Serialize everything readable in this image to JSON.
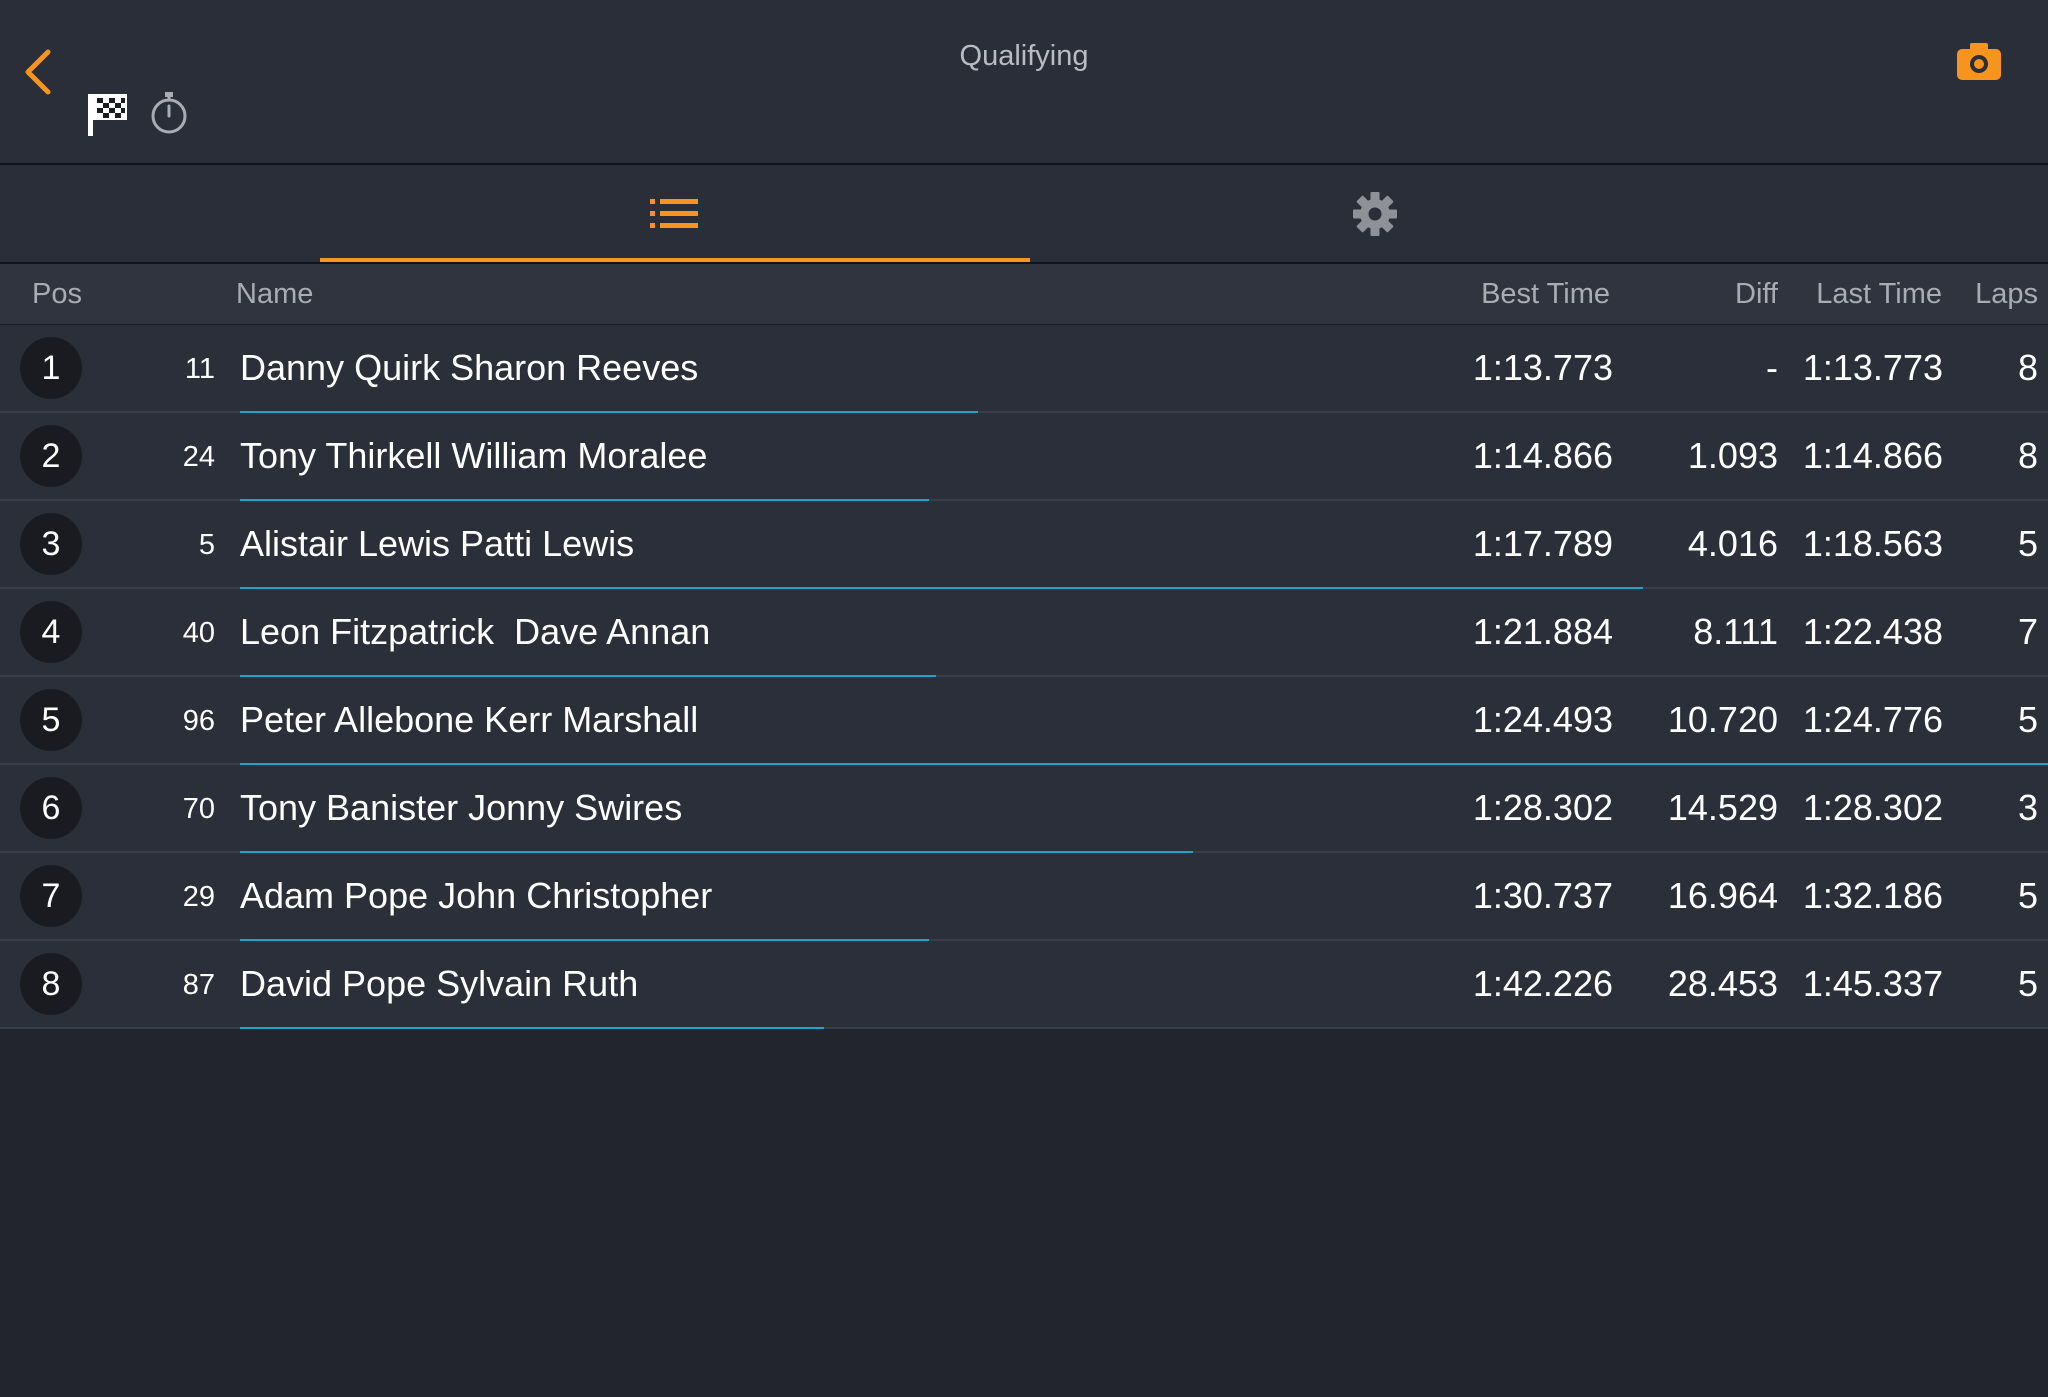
{
  "header": {
    "title": "Qualifying"
  },
  "columns": {
    "pos": "Pos",
    "name": "Name",
    "best_time": "Best Time",
    "diff": "Diff",
    "last_time": "Last Time",
    "laps": "Laps"
  },
  "colors": {
    "accent": "#f7941d",
    "progress": "#1aa6c8",
    "background": "#22252d"
  },
  "rows": [
    {
      "pos": "1",
      "car": "11",
      "name": "Danny Quirk Sharon Reeves",
      "best": "1:13.773",
      "diff": "-",
      "last": "1:13.773",
      "laps": "8",
      "progress": 0.408
    },
    {
      "pos": "2",
      "car": "24",
      "name": "Tony Thirkell William Moralee",
      "best": "1:14.866",
      "diff": "1.093",
      "last": "1:14.866",
      "laps": "8",
      "progress": 0.381
    },
    {
      "pos": "3",
      "car": "5",
      "name": "Alistair Lewis Patti Lewis",
      "best": "1:17.789",
      "diff": "4.016",
      "last": "1:18.563",
      "laps": "5",
      "progress": 0.776
    },
    {
      "pos": "4",
      "car": "40",
      "name": "Leon Fitzpatrick  Dave Annan",
      "best": "1:21.884",
      "diff": "8.111",
      "last": "1:22.438",
      "laps": "7",
      "progress": 0.385
    },
    {
      "pos": "5",
      "car": "96",
      "name": "Peter Allebone Kerr Marshall",
      "best": "1:24.493",
      "diff": "10.720",
      "last": "1:24.776",
      "laps": "5",
      "progress": 1.0
    },
    {
      "pos": "6",
      "car": "70",
      "name": "Tony Banister Jonny Swires",
      "best": "1:28.302",
      "diff": "14.529",
      "last": "1:28.302",
      "laps": "3",
      "progress": 0.527
    },
    {
      "pos": "7",
      "car": "29",
      "name": "Adam Pope John Christopher",
      "best": "1:30.737",
      "diff": "16.964",
      "last": "1:32.186",
      "laps": "5",
      "progress": 0.381
    },
    {
      "pos": "8",
      "car": "87",
      "name": "David Pope Sylvain Ruth",
      "best": "1:42.226",
      "diff": "28.453",
      "last": "1:45.337",
      "laps": "5",
      "progress": 0.323
    }
  ],
  "icons": {
    "back": "chevron-left-icon",
    "flag": "checkered-flag-icon",
    "stopwatch": "stopwatch-icon",
    "camera": "camera-icon",
    "list": "list-icon",
    "settings": "gear-icon"
  }
}
